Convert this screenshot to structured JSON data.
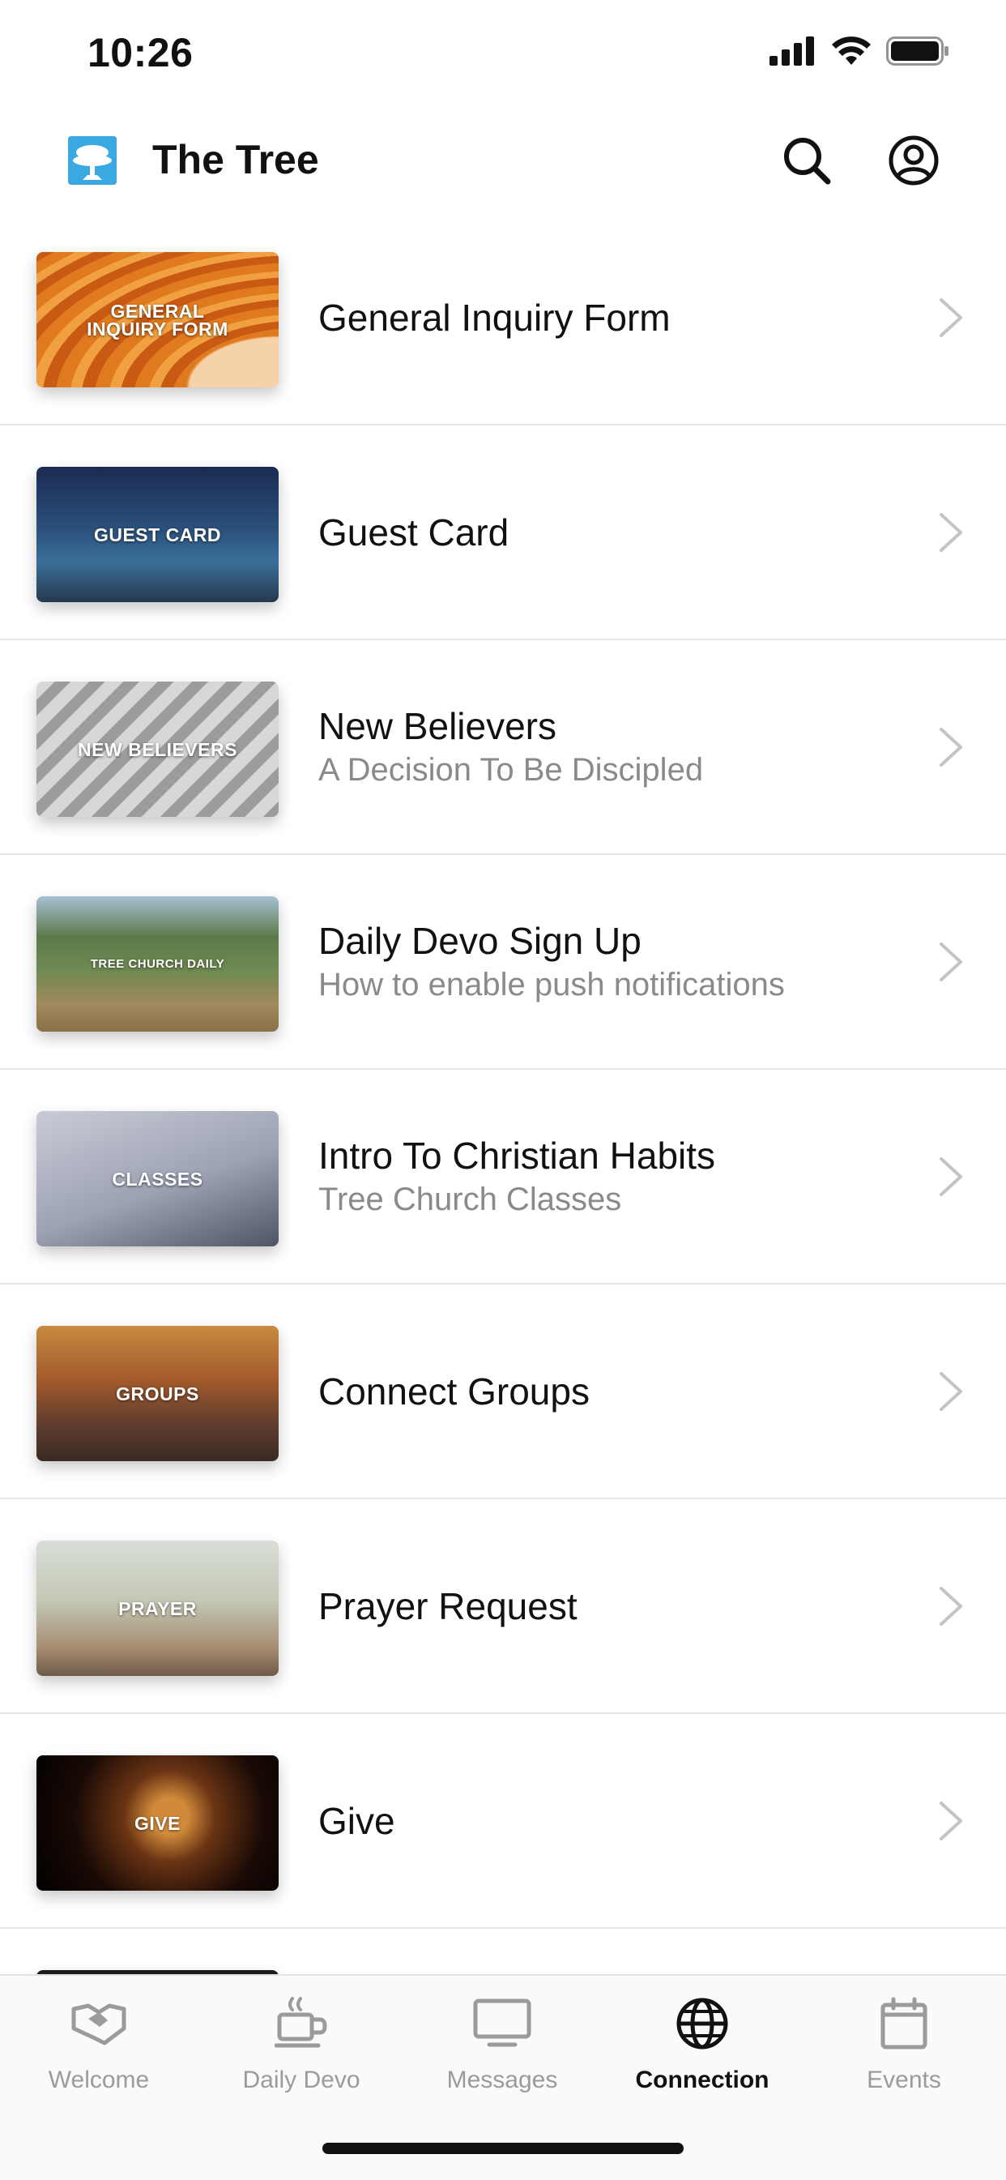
{
  "status_bar": {
    "time": "10:26"
  },
  "header": {
    "app_title": "The Tree",
    "icons": {
      "logo": "tree-logo-icon",
      "search": "search-icon",
      "account": "account-icon"
    }
  },
  "list": {
    "items": [
      {
        "thumb_text": "GENERAL INQUIRY FORM",
        "title": "General Inquiry Form",
        "subtitle": ""
      },
      {
        "thumb_text": "GUEST CARD",
        "title": "Guest Card",
        "subtitle": ""
      },
      {
        "thumb_text": "NEW BELIEVERS",
        "title": "New Believers",
        "subtitle": "A Decision To Be Discipled"
      },
      {
        "thumb_text": "TREE CHURCH DAILY",
        "title": "Daily Devo Sign Up",
        "subtitle": "How to enable push notifications"
      },
      {
        "thumb_text": "CLASSES",
        "title": "Intro To Christian Habits",
        "subtitle": "Tree Church Classes"
      },
      {
        "thumb_text": "GROUPS",
        "title": "Connect Groups",
        "subtitle": ""
      },
      {
        "thumb_text": "PRAYER",
        "title": "Prayer Request",
        "subtitle": ""
      },
      {
        "thumb_text": "GIVE",
        "title": "Give",
        "subtitle": ""
      }
    ]
  },
  "tab_bar": {
    "tabs": [
      {
        "label": "Welcome",
        "icon": "handshake-icon"
      },
      {
        "label": "Daily Devo",
        "icon": "coffee-cup-icon"
      },
      {
        "label": "Messages",
        "icon": "tv-icon"
      },
      {
        "label": "Connection",
        "icon": "globe-icon"
      },
      {
        "label": "Events",
        "icon": "calendar-icon"
      }
    ],
    "active_index": 3
  },
  "colors": {
    "accent_active": "#111111",
    "inactive": "#9b9b9b",
    "logo_blue": "#3aa9e2"
  }
}
